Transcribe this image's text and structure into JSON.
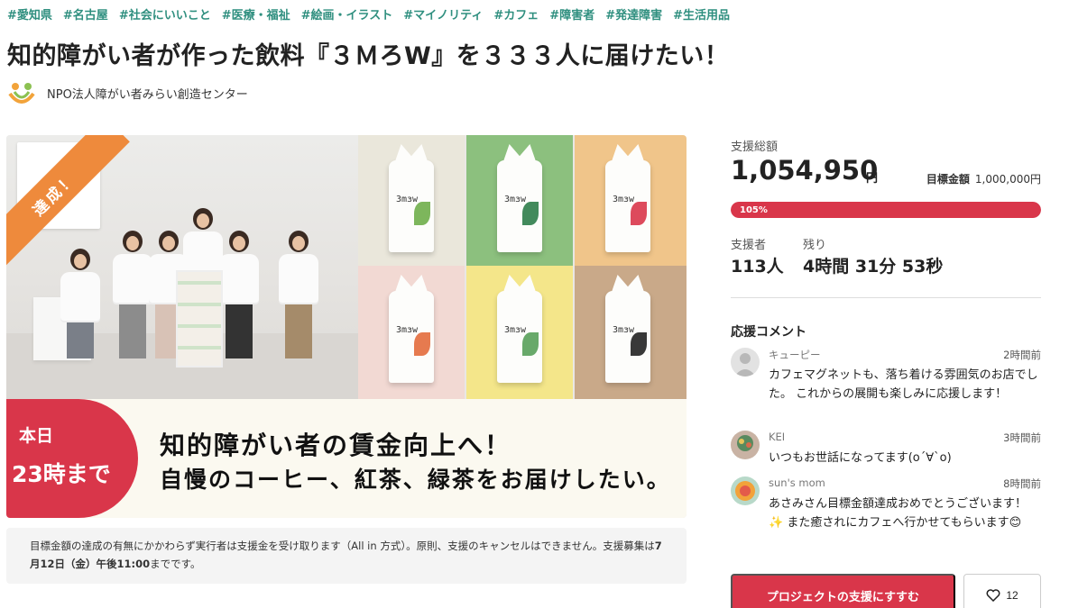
{
  "tags": [
    "#愛知県",
    "#名古屋",
    "#社会にいいこと",
    "#医療・福祉",
    "#絵画・イラスト",
    "#マイノリティ",
    "#カフェ",
    "#障害者",
    "#発達障害",
    "#生活用品"
  ],
  "title": "知的障がい者が作った飲料『３ＭろW』を３３３人に届けたい！",
  "owner": {
    "name": "NPO法人障がい者みらい創造センター"
  },
  "visual": {
    "ribbon": "達成！",
    "deadline_line1": "本日",
    "deadline_line2": "23時まで",
    "headline1": "知的障がい者の賃金向上へ！",
    "headline2": "自慢のコーヒー、紅茶、緑茶をお届けしたい。"
  },
  "notice": {
    "text_a": "目標金額の達成の有無にかかわらず実行者は支援金を受け取ります（All in 方式）。原則、支援のキャンセルはできません。支援募集は",
    "text_b": "7月12日（金）午後11:00",
    "text_c": "までです。"
  },
  "stats": {
    "total_label": "支援総額",
    "total": "1,054,950",
    "total_unit": "円",
    "goal_label": "目標金額",
    "goal": "1,000,000円",
    "progress_text": "105%",
    "progress": 1.05,
    "supporters_label": "支援者",
    "supporters": "113人",
    "remaining_label": "残り",
    "remaining": "4時間 31分 53秒"
  },
  "comments": {
    "heading": "応援コメント",
    "items": [
      {
        "name": "キューピー",
        "time": "2時間前",
        "text": "カフェマグネットも、落ち着ける雰囲気のお店でした。 これからの展開も楽しみに応援します！"
      },
      {
        "name": "KEI",
        "time": "3時間前",
        "text": "いつもお世話になってます(o´∀`o)"
      },
      {
        "name": "sun's mom",
        "time": "8時間前",
        "text": "あさみさん目標金額達成おめでとうございます！✨ また癒されにカフェへ行かせてもらいます😊"
      }
    ]
  },
  "cta": {
    "label": "プロジェクトの支援にすすむ"
  },
  "like": {
    "count": "12"
  },
  "colors": {
    "accent": "#d9364a",
    "tag": "#2f8f7f",
    "ribbon": "#ee8a3c"
  }
}
